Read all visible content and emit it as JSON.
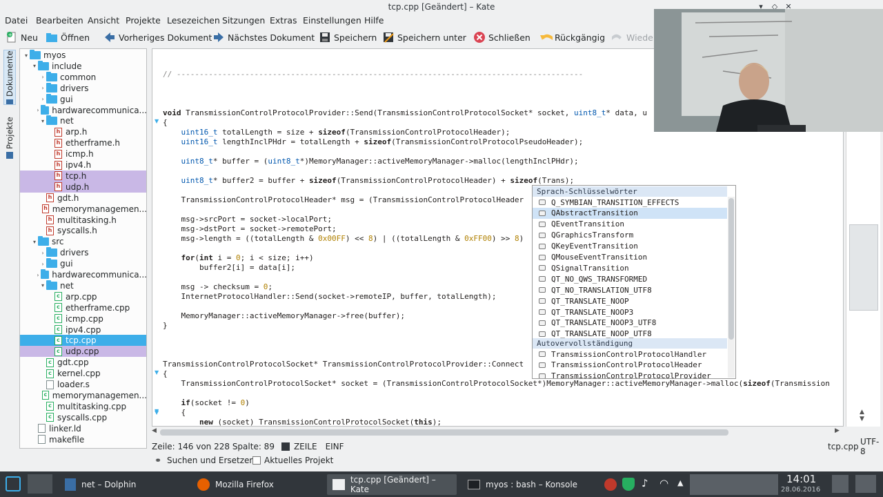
{
  "window": {
    "title": "tcp.cpp [Geändert] – Kate"
  },
  "menu": [
    "Datei",
    "Bearbeiten",
    "Ansicht",
    "Projekte",
    "Lesezeichen",
    "Sitzungen",
    "Extras",
    "Einstellungen",
    "Hilfe"
  ],
  "toolbar": {
    "new": "Neu",
    "open": "Öffnen",
    "prev": "Vorheriges Dokument",
    "next": "Nächstes Dokument",
    "save": "Speichern",
    "saveas": "Speichern unter",
    "close": "Schließen",
    "undo": "Rückgängig",
    "redo": "Wieder"
  },
  "sidetabs": {
    "documents": "Dokumente",
    "projects": "Projekte"
  },
  "tree": [
    {
      "t": "myos",
      "kind": "folder",
      "lvl": 0,
      "open": true
    },
    {
      "t": "include",
      "kind": "folder",
      "lvl": 1,
      "open": true
    },
    {
      "t": "common",
      "kind": "folder",
      "lvl": 2,
      "open": false
    },
    {
      "t": "drivers",
      "kind": "folder",
      "lvl": 2,
      "open": false
    },
    {
      "t": "gui",
      "kind": "folder",
      "lvl": 2,
      "open": false
    },
    {
      "t": "hardwarecommunica...",
      "kind": "folder",
      "lvl": 2,
      "open": false
    },
    {
      "t": "net",
      "kind": "folder",
      "lvl": 2,
      "open": true
    },
    {
      "t": "arp.h",
      "kind": "h",
      "lvl": 3
    },
    {
      "t": "etherframe.h",
      "kind": "h",
      "lvl": 3
    },
    {
      "t": "icmp.h",
      "kind": "h",
      "lvl": 3
    },
    {
      "t": "ipv4.h",
      "kind": "h",
      "lvl": 3
    },
    {
      "t": "tcp.h",
      "kind": "h",
      "lvl": 3,
      "sel": "p"
    },
    {
      "t": "udp.h",
      "kind": "h",
      "lvl": 3,
      "sel": "p"
    },
    {
      "t": "gdt.h",
      "kind": "h",
      "lvl": 2
    },
    {
      "t": "memorymanagemen...",
      "kind": "h",
      "lvl": 2
    },
    {
      "t": "multitasking.h",
      "kind": "h",
      "lvl": 2
    },
    {
      "t": "syscalls.h",
      "kind": "h",
      "lvl": 2
    },
    {
      "t": "src",
      "kind": "folder",
      "lvl": 1,
      "open": true
    },
    {
      "t": "drivers",
      "kind": "folder",
      "lvl": 2,
      "open": false
    },
    {
      "t": "gui",
      "kind": "folder",
      "lvl": 2,
      "open": false
    },
    {
      "t": "hardwarecommunica...",
      "kind": "folder",
      "lvl": 2,
      "open": false
    },
    {
      "t": "net",
      "kind": "folder",
      "lvl": 2,
      "open": true
    },
    {
      "t": "arp.cpp",
      "kind": "c",
      "lvl": 3
    },
    {
      "t": "etherframe.cpp",
      "kind": "c",
      "lvl": 3
    },
    {
      "t": "icmp.cpp",
      "kind": "c",
      "lvl": 3
    },
    {
      "t": "ipv4.cpp",
      "kind": "c",
      "lvl": 3
    },
    {
      "t": "tcp.cpp",
      "kind": "c",
      "lvl": 3,
      "sel": "b"
    },
    {
      "t": "udp.cpp",
      "kind": "c",
      "lvl": 3,
      "sel": "p"
    },
    {
      "t": "gdt.cpp",
      "kind": "c",
      "lvl": 2
    },
    {
      "t": "kernel.cpp",
      "kind": "c",
      "lvl": 2
    },
    {
      "t": "loader.s",
      "kind": "g",
      "lvl": 2
    },
    {
      "t": "memorymanagemen...",
      "kind": "c",
      "lvl": 2
    },
    {
      "t": "multitasking.cpp",
      "kind": "c",
      "lvl": 2
    },
    {
      "t": "syscalls.cpp",
      "kind": "c",
      "lvl": 2
    },
    {
      "t": "linker.ld",
      "kind": "g",
      "lvl": 1
    },
    {
      "t": "makefile",
      "kind": "g",
      "lvl": 1
    }
  ],
  "code": [
    "// -----------------------------------------------------------------------------------------",
    "void TransmissionControlProtocolProvider::Send(TransmissionControlProtocolSocket* socket, uint8_t* data, u",
    "{",
    "    uint16_t totalLength = size + sizeof(TransmissionControlProtocolHeader);",
    "    uint16_t lengthInclPHdr = totalLength + sizeof(TransmissionControlProtocolPseudoHeader);",
    "    uint8_t* buffer = (uint8_t*)MemoryManager::activeMemoryManager->malloc(lengthInclPHdr);",
    "    uint8_t* buffer2 = buffer + sizeof(TransmissionControlProtocolHeader) + sizeof(Trans);",
    "    TransmissionControlProtocolHeader* msg = (TransmissionControlProtocolHeader",
    "    msg->srcPort = socket->localPort;",
    "    msg->dstPort = socket->remotePort;",
    "    msg->length = ((totalLength & 0x00FF) << 8) | ((totalLength & 0xFF00) >> 8)",
    "    for(int i = 0; i < size; i++)",
    "        buffer2[i] = data[i];",
    "    msg -> checksum = 0;",
    "    InternetProtocolHandler::Send(socket->remoteIP, buffer, totalLength);",
    "    MemoryManager::activeMemoryManager->free(buffer);",
    "}",
    "TransmissionControlProtocolSocket* TransmissionControlProtocolProvider::Connect",
    "{",
    "    TransmissionControlProtocolSocket* socket = (TransmissionControlProtocolSocket*)MemoryManager::activeMemoryManager->malloc(sizeof(Transmission",
    "    if(socket != 0)",
    "    {",
    "        new (socket) TransmissionControlProtocolSocket(this);"
  ],
  "completion": {
    "group1": "Sprach-Schlüsselwörter",
    "items1": [
      "Q_SYMBIAN_TRANSITION_EFFECTS",
      "QAbstractTransition",
      "QEventTransition",
      "QGraphicsTransform",
      "QKeyEventTransition",
      "QMouseEventTransition",
      "QSignalTransition",
      "QT_NO_QWS_TRANSFORMED",
      "QT_NO_TRANSLATION_UTF8",
      "QT_TRANSLATE_NOOP",
      "QT_TRANSLATE_NOOP3",
      "QT_TRANSLATE_NOOP3_UTF8",
      "QT_TRANSLATE_NOOP_UTF8"
    ],
    "group2": "Autovervollständigung",
    "items2": [
      "TransmissionControlProtocolHandler",
      "TransmissionControlProtocolHeader",
      "TransmissionControlProtocolProvider"
    ]
  },
  "status": {
    "pos": "Zeile: 146 von 228 Spalte: 89",
    "mode": "ZEILE",
    "ins": "EINF",
    "file": "tcp.cpp",
    "enc": "UTF-8"
  },
  "bottom": {
    "search": "Suchen und Ersetzen",
    "project": "Aktuelles Projekt"
  },
  "taskbar": {
    "tasks": [
      "net – Dolphin",
      "Mozilla Firefox",
      "tcp.cpp [Geändert] – Kate",
      "myos : bash – Konsole"
    ],
    "time": "14:01",
    "date": "28.06.2016"
  }
}
